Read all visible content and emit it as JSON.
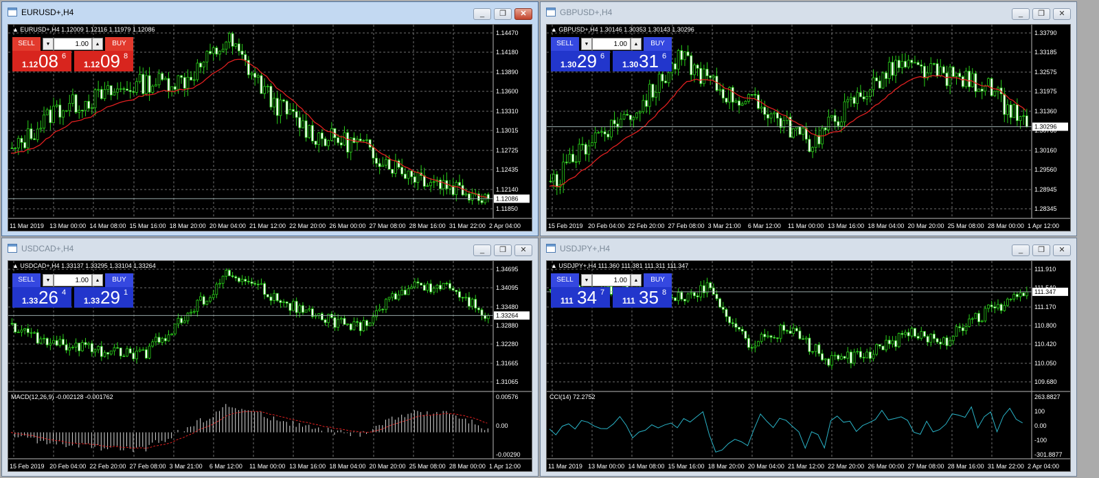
{
  "windows": [
    {
      "id": "eurusd",
      "title": "EURUSD+,H4",
      "active": true,
      "header": "EURUSD+,H4  1.12009 1.12116 1.11979 1.12086",
      "panel_color": "red",
      "trade": {
        "sell_label": "SELL",
        "buy_label": "BUY",
        "lot": "1.00",
        "sell_big": "1.12",
        "sell_main": "08",
        "sell_sup": "6",
        "buy_big": "1.12",
        "buy_main": "09",
        "buy_sup": "8"
      },
      "price_labels": [
        "1.14470",
        "1.14180",
        "1.13890",
        "1.13600",
        "1.13310",
        "1.13015",
        "1.12725",
        "1.12435",
        "1.12140",
        "1.11850"
      ],
      "current_price": "1.12086",
      "time_labels": [
        "11 Mar 2019",
        "13 Mar 00:00",
        "14 Mar 08:00",
        "15 Mar 16:00",
        "18 Mar 20:00",
        "20 Mar 04:00",
        "21 Mar 12:00",
        "22 Mar 20:00",
        "26 Mar 00:00",
        "27 Mar 08:00",
        "28 Mar 16:00",
        "31 Mar 22:00",
        "2 Apr 04:00"
      ],
      "series_seed": [
        0.3,
        0.55,
        0.62,
        0.7,
        0.72,
        0.95,
        0.6,
        0.4,
        0.35,
        0.2,
        0.12,
        0.05
      ],
      "ma": true,
      "indicator": null
    },
    {
      "id": "gbpusd",
      "title": "GBPUSD+,H4",
      "active": false,
      "header": "GBPUSD+,H4  1.30146 1.30353 1.30143 1.30296",
      "panel_color": "blue",
      "trade": {
        "sell_label": "SELL",
        "buy_label": "BUY",
        "lot": "1.00",
        "sell_big": "1.30",
        "sell_main": "29",
        "sell_sup": "6",
        "buy_big": "1.30",
        "buy_main": "31",
        "buy_sup": "6"
      },
      "price_labels": [
        "1.33790",
        "1.33185",
        "1.32575",
        "1.31975",
        "1.31360",
        "1.30760",
        "1.30160",
        "1.29560",
        "1.28945",
        "1.28345"
      ],
      "current_price": "1.30296",
      "time_labels": [
        "15 Feb 2019",
        "20 Feb 04:00",
        "22 Feb 20:00",
        "27 Feb 08:00",
        "3 Mar 21:00",
        "6 Mar 12:00",
        "11 Mar 00:00",
        "13 Mar 16:00",
        "18 Mar 04:00",
        "20 Mar 20:00",
        "25 Mar 08:00",
        "28 Mar 00:00",
        "1 Apr 12:00"
      ],
      "series_seed": [
        0.1,
        0.4,
        0.55,
        0.85,
        0.65,
        0.55,
        0.35,
        0.6,
        0.8,
        0.75,
        0.7,
        0.45
      ],
      "ma": true,
      "indicator": null
    },
    {
      "id": "usdcad",
      "title": "USDCAD+,H4",
      "active": false,
      "header": "USDCAD+,H4  1.33137 1.33295 1.33104 1.33264",
      "panel_color": "blue",
      "trade": {
        "sell_label": "SELL",
        "buy_label": "BUY",
        "lot": "1.00",
        "sell_big": "1.33",
        "sell_main": "26",
        "sell_sup": "4",
        "buy_big": "1.33",
        "buy_main": "29",
        "buy_sup": "1"
      },
      "price_labels": [
        "1.34695",
        "1.34095",
        "1.33480",
        "1.32880",
        "1.32280",
        "1.31665",
        "1.31065"
      ],
      "current_price": "1.33264",
      "time_labels": [
        "15 Feb 2019",
        "20 Feb 04:00",
        "22 Feb 20:00",
        "27 Feb 08:00",
        "3 Mar 21:00",
        "6 Mar 12:00",
        "11 Mar 00:00",
        "13 Mar 16:00",
        "18 Mar 04:00",
        "20 Mar 20:00",
        "25 Mar 08:00",
        "28 Mar 00:00",
        "1 Apr 12:00"
      ],
      "series_seed": [
        0.45,
        0.3,
        0.25,
        0.2,
        0.55,
        0.95,
        0.75,
        0.55,
        0.45,
        0.8,
        0.85,
        0.55
      ],
      "ma": false,
      "indicator": {
        "label": "MACD(12,26,9) -0.002128 -0.001762",
        "labels": [
          "0.00576",
          "0.00",
          "-0.00290"
        ],
        "type": "macd"
      }
    },
    {
      "id": "usdjpy",
      "title": "USDJPY+,H4",
      "active": false,
      "header": "USDJPY+,H4  111.360 111.381 111.311 111.347",
      "panel_color": "blue",
      "trade": {
        "sell_label": "SELL",
        "buy_label": "BUY",
        "lot": "1.00",
        "sell_big": "111",
        "sell_main": "34",
        "sell_sup": "7",
        "buy_big": "111",
        "buy_main": "35",
        "buy_sup": "8"
      },
      "price_labels": [
        "111.910",
        "111.540",
        "111.170",
        "110.800",
        "110.420",
        "110.050",
        "109.680"
      ],
      "current_price": "111.347",
      "time_labels": [
        "11 Mar 2019",
        "13 Mar 00:00",
        "14 Mar 08:00",
        "15 Mar 16:00",
        "18 Mar 20:00",
        "20 Mar 04:00",
        "21 Mar 12:00",
        "22 Mar 20:00",
        "26 Mar 00:00",
        "27 Mar 08:00",
        "28 Mar 16:00",
        "31 Mar 22:00",
        "2 Apr 04:00"
      ],
      "series_seed": [
        0.75,
        0.8,
        0.78,
        0.7,
        0.82,
        0.3,
        0.45,
        0.15,
        0.2,
        0.4,
        0.35,
        0.6,
        0.75
      ],
      "ma": false,
      "indicator": {
        "label": "CCI(14) 72.2752",
        "labels": [
          "263.8827",
          "100",
          "0.00",
          "-100",
          "-301.8877"
        ],
        "type": "cci"
      }
    }
  ],
  "colors": {
    "candle": "#2ad21a",
    "ma": "#e02020",
    "grid": "#707070",
    "axis_text": "#ffffff",
    "signal": "#e02020",
    "cci": "#2ab4c8"
  }
}
